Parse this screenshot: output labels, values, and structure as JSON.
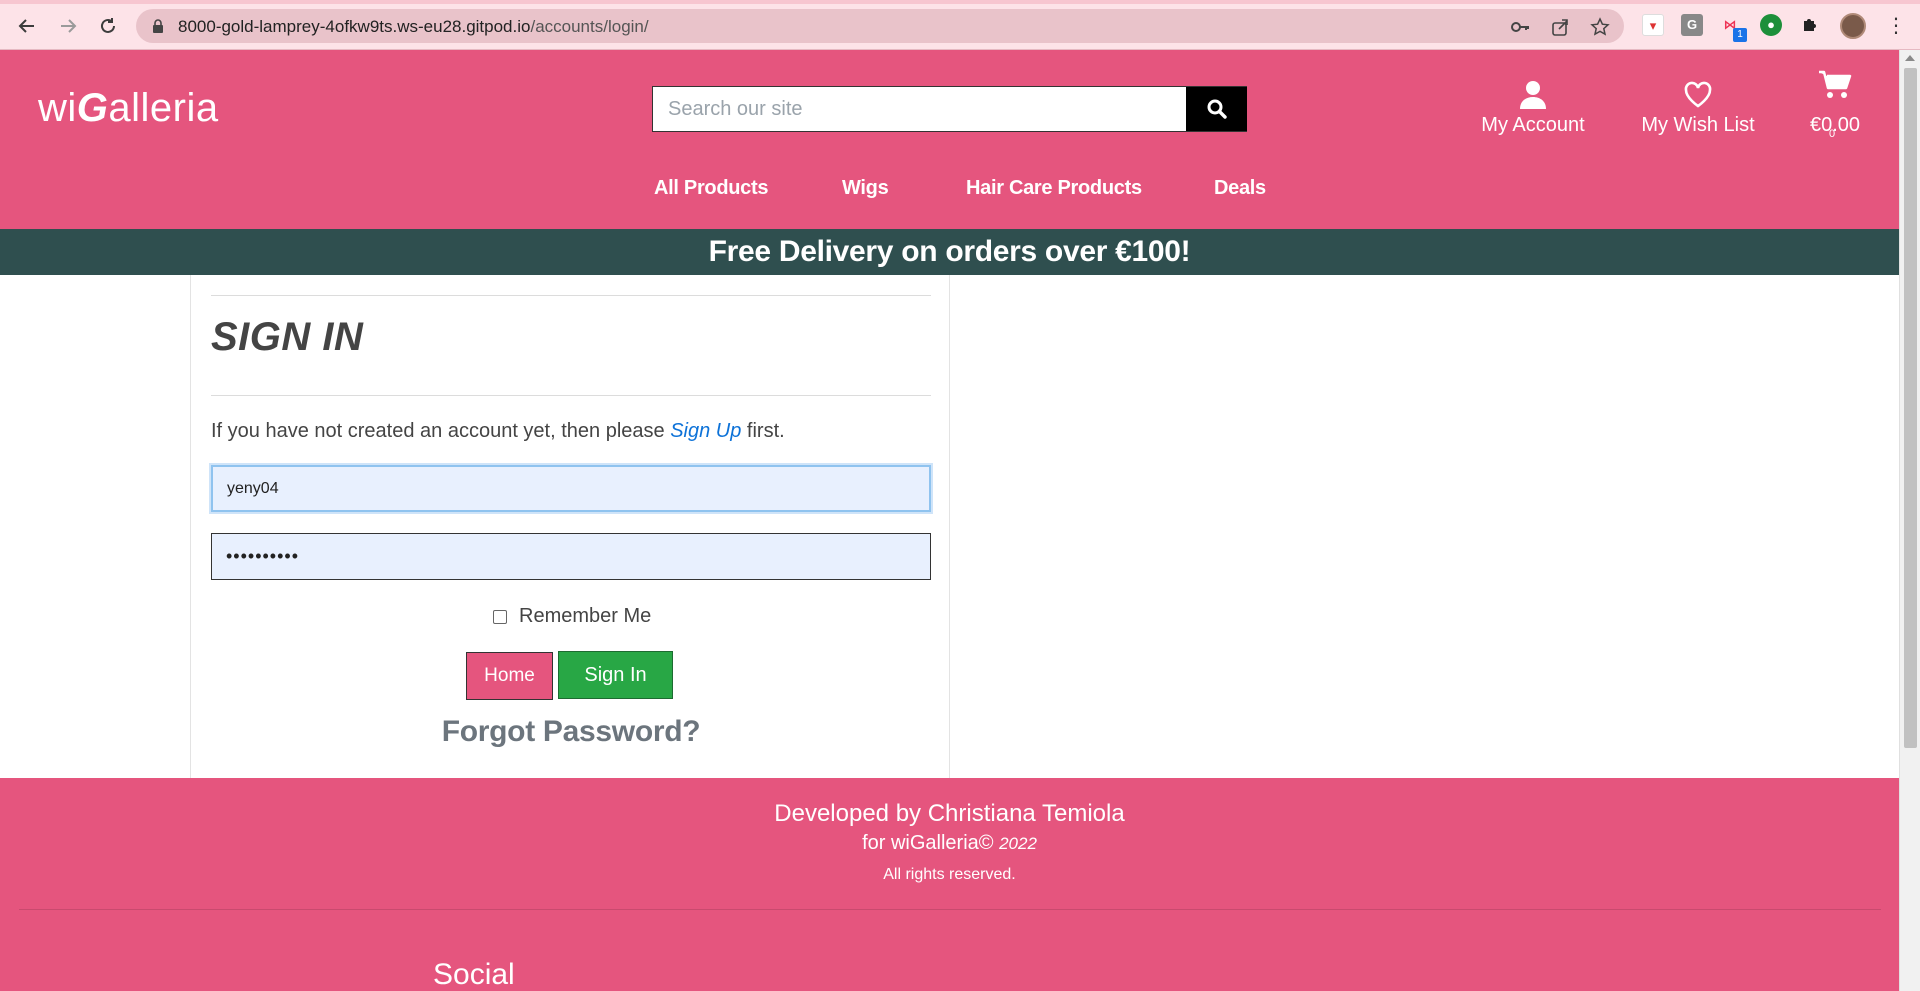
{
  "browser": {
    "url_host": "8000-gold-lamprey-4ofkw9ts.ws-eu28.gitpod.io",
    "url_path": "/accounts/login/",
    "extension_badge": "1"
  },
  "header": {
    "logo_prefix": "wi",
    "logo_g": "G",
    "logo_suffix": "alleria",
    "search_placeholder": "Search our site",
    "account_label": "My Account",
    "wishlist_label": "My Wish List",
    "cart_total": "€0.00",
    "cart_count": "0"
  },
  "nav": {
    "items": [
      "All Products",
      "Wigs",
      "Hair Care Products",
      "Deals"
    ]
  },
  "banner": {
    "text": "Free Delivery on orders over €100!"
  },
  "signin": {
    "title": "SIGN IN",
    "note_before": "If you have not created an account yet, then please ",
    "signup_link": "Sign Up",
    "note_after": " first.",
    "username_value": "yeny04",
    "password_value": "••••••••••",
    "remember_label": "Remember Me",
    "home_button": "Home",
    "signin_button": "Sign In",
    "forgot_password": "Forgot Password?"
  },
  "footer": {
    "developed_by": "Developed by Christiana Temiola",
    "for_text": "for wiGalleria©",
    "year": "2022",
    "rights": "All rights reserved.",
    "social_heading": "Social"
  },
  "colors": {
    "brand_pink": "#e5557e",
    "banner_dark": "#2f4f4f",
    "success_green": "#28a745",
    "link_blue": "#0d72d8"
  }
}
